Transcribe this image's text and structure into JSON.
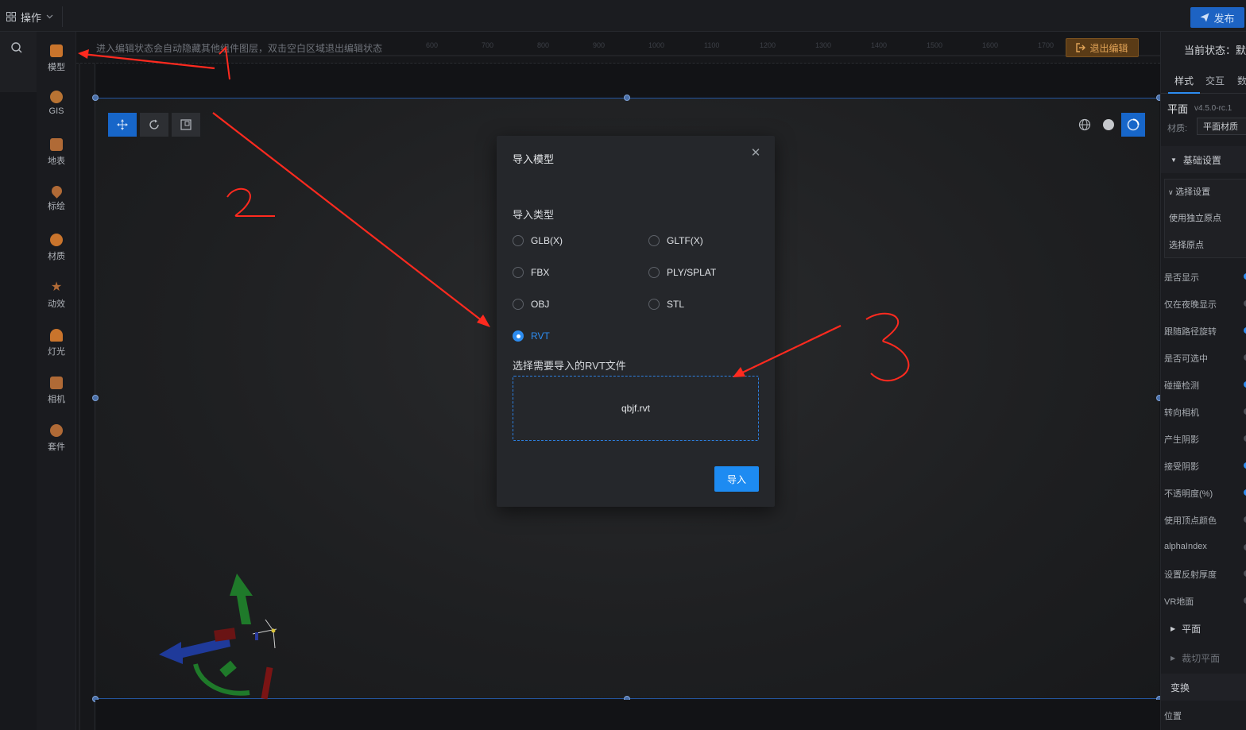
{
  "topbar": {
    "menu_label": "操作",
    "publish_label": "发布"
  },
  "sidebar": {
    "items": [
      {
        "label": "模型",
        "color": "#c9742c"
      },
      {
        "label": "GIS",
        "color": "#b87333"
      },
      {
        "label": "地表",
        "color": "#b06a36"
      },
      {
        "label": "标绘",
        "color": "#b06a36"
      },
      {
        "label": "材质",
        "color": "#c9742c"
      },
      {
        "label": "动效",
        "color": "#b06a36"
      },
      {
        "label": "灯光",
        "color": "#c9742c"
      },
      {
        "label": "相机",
        "color": "#b06a36"
      },
      {
        "label": "套件",
        "color": "#b06a36"
      }
    ]
  },
  "editor": {
    "hint": "进入编辑状态会自动隐藏其他组件图层，双击空白区域退出编辑状态",
    "exit_label": "退出编辑"
  },
  "modal": {
    "title": "导入模型",
    "type_label": "导入类型",
    "options": [
      {
        "label": "GLB(X)",
        "checked": false
      },
      {
        "label": "GLTF(X)",
        "checked": false
      },
      {
        "label": "FBX",
        "checked": false
      },
      {
        "label": "PLY/SPLAT",
        "checked": false
      },
      {
        "label": "OBJ",
        "checked": false
      },
      {
        "label": "STL",
        "checked": false
      },
      {
        "label": "RVT",
        "checked": true
      }
    ],
    "file_label": "选择需要导入的RVT文件",
    "file_name": "qbjf.rvt",
    "import_label": "导入"
  },
  "right_panel": {
    "status": "当前状态：默",
    "tabs": [
      "样式",
      "交互",
      "数"
    ],
    "component_name": "平面",
    "version": "v4.5.0-rc.1",
    "material_label": "材质:",
    "material_value": "平面材质",
    "basic_section": "基础设置",
    "select_group": "选择设置",
    "use_origin": "使用独立原点",
    "pick_origin": "选择原点",
    "rows": [
      {
        "label": "是否显示",
        "on": true
      },
      {
        "label": "仅在夜晚显示",
        "on": false
      },
      {
        "label": "跟随路径旋转",
        "on": true
      },
      {
        "label": "是否可选中",
        "on": false
      },
      {
        "label": "碰撞检测",
        "on": true
      },
      {
        "label": "转向相机",
        "on": false
      },
      {
        "label": "产生阴影",
        "on": false
      },
      {
        "label": "接受阴影",
        "on": true
      },
      {
        "label": "不透明度(%)",
        "on": true
      },
      {
        "label": "使用顶点颜色",
        "on": false
      },
      {
        "label": "alphaIndex",
        "on": false
      },
      {
        "label": "设置反射厚度",
        "on": false
      },
      {
        "label": "VR地面",
        "on": false
      }
    ],
    "plane_section": "平面",
    "clip_section": "裁切平面",
    "transform_section": "变换",
    "position_label": "位置"
  },
  "annotations": {
    "one": "1",
    "two": "2",
    "three": "3"
  }
}
